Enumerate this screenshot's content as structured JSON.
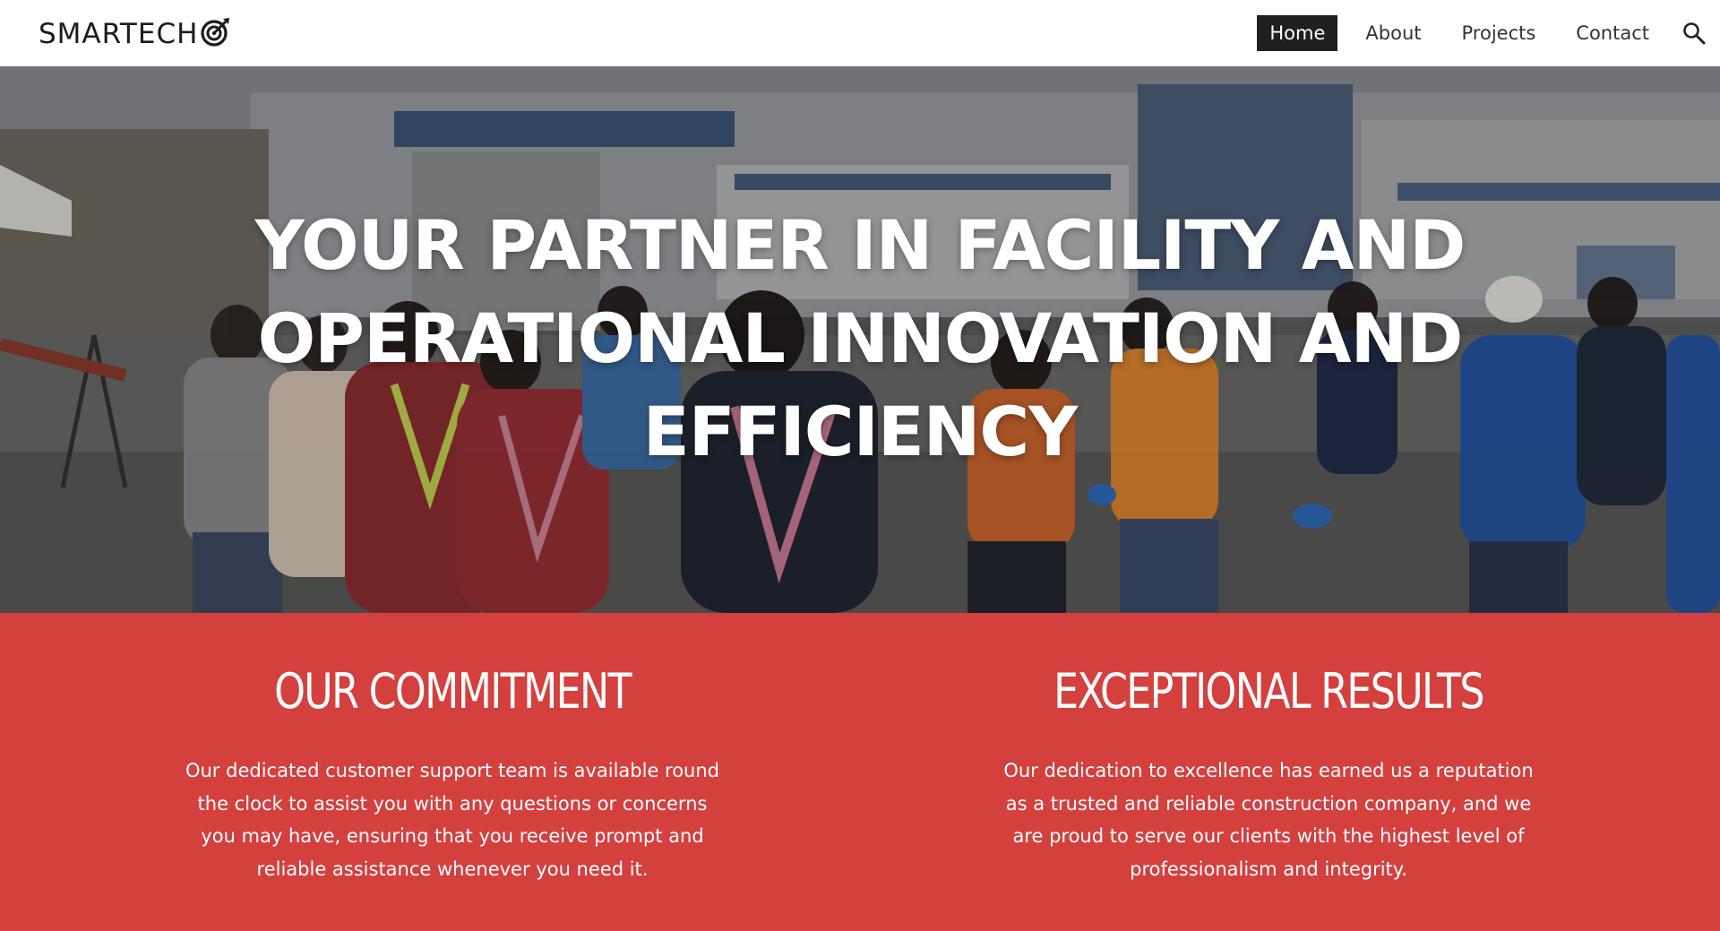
{
  "header": {
    "logo_text": "SMARTECH",
    "logo_icon": "target-icon",
    "nav": [
      {
        "label": "Home",
        "active": true
      },
      {
        "label": "About",
        "active": false
      },
      {
        "label": "Projects",
        "active": false
      },
      {
        "label": "Contact",
        "active": false
      }
    ],
    "search_icon": "search-icon"
  },
  "hero": {
    "title": "YOUR PARTNER IN FACILITY AND OPERATIONAL INNOVATION AND EFFICIENCY"
  },
  "features": [
    {
      "title": "OUR COMMITMENT",
      "text": "Our dedicated customer support team is available round the clock to assist you with any questions or concerns you may have, ensuring that you receive prompt and reliable assistance whenever you need it."
    },
    {
      "title": "EXCEPTIONAL RESULTS",
      "text": "Our dedication to excellence has earned us a reputation as a trusted and reliable construction company, and we are proud to serve our clients with the highest level of professionalism and integrity."
    }
  ],
  "colors": {
    "accent_red": "#d4403e",
    "nav_active_bg": "#1f1f1f",
    "text_dark": "#1c1c1c"
  }
}
